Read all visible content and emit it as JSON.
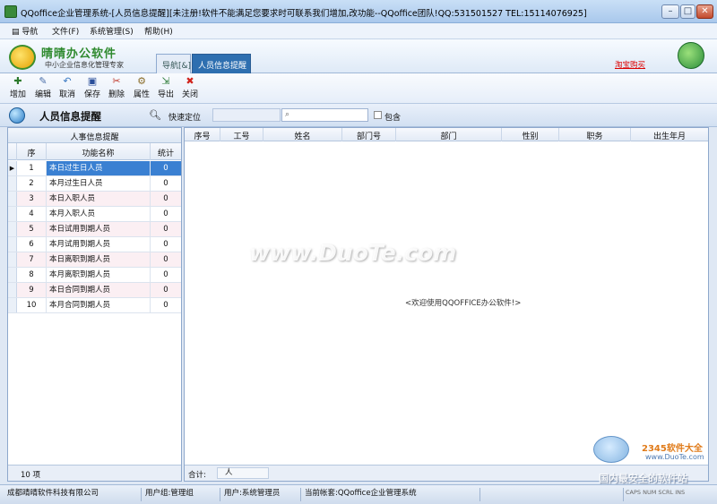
{
  "window": {
    "title": "QQoffice企业管理系统-[人员信息提醒][未注册!软件不能满足您要求时可联系我们增加,改功能--QQoffice团队!QQ:531501527 TEL:15114076925]"
  },
  "menu": {
    "items": [
      {
        "label": "导航"
      },
      {
        "label": "文件(F)"
      },
      {
        "label": "系统管理(S)"
      },
      {
        "label": "帮助(H)"
      }
    ]
  },
  "brand": {
    "title": "晴晴办公软件",
    "subtitle": "中小企业信息化管理专家",
    "taobao": "淘宝购买"
  },
  "tabs": [
    {
      "label": "导航[&]"
    },
    {
      "label": "人员信息提醒"
    }
  ],
  "toolbar": {
    "buttons": [
      {
        "label": "增加",
        "icon": "plus-icon"
      },
      {
        "label": "编辑",
        "icon": "edit-icon"
      },
      {
        "label": "取消",
        "icon": "undo-icon"
      },
      {
        "label": "保存",
        "icon": "save-icon"
      },
      {
        "label": "删除",
        "icon": "delete-icon"
      },
      {
        "label": "属性",
        "icon": "properties-icon"
      },
      {
        "label": "导出",
        "icon": "export-icon"
      },
      {
        "label": "关闭",
        "icon": "close-icon"
      }
    ]
  },
  "section": {
    "title": "人员信息提醒",
    "quick_locate": "快速定位",
    "search_placeholder": "",
    "contains_label": "包含"
  },
  "left_panel": {
    "header": "人事信息提醒",
    "columns": [
      "序",
      "功能名称",
      "统计"
    ],
    "rows": [
      {
        "no": "1",
        "name": "本日过生日人员",
        "count": "0"
      },
      {
        "no": "2",
        "name": "本月过生日人员",
        "count": "0"
      },
      {
        "no": "3",
        "name": "本日入职人员",
        "count": "0"
      },
      {
        "no": "4",
        "name": "本月入职人员",
        "count": "0"
      },
      {
        "no": "5",
        "name": "本日试用到期人员",
        "count": "0"
      },
      {
        "no": "6",
        "name": "本月试用到期人员",
        "count": "0"
      },
      {
        "no": "7",
        "name": "本日离职到期人员",
        "count": "0"
      },
      {
        "no": "8",
        "name": "本月离职到期人员",
        "count": "0"
      },
      {
        "no": "9",
        "name": "本日合同到期人员",
        "count": "0"
      },
      {
        "no": "10",
        "name": "本月合同到期人员",
        "count": "0"
      }
    ],
    "footer": "10 项"
  },
  "right_panel": {
    "columns": [
      "序号",
      "工号",
      "姓名",
      "部门号",
      "部门",
      "性别",
      "职务",
      "出生年月"
    ],
    "welcome": "<欢迎使用QQOFFICE办公软件!>",
    "total_label": "合计:",
    "total_value": "人"
  },
  "status": {
    "company": "成都晴晴软件科技有限公司",
    "usergroup": "用户组:管理组",
    "user": "用户:系统管理员",
    "account": "当前帐套:QQoffice企业管理系统",
    "keys": "CAPS NUM SCRL INS"
  },
  "watermarks": {
    "duote": "www.DuoTe.com",
    "brand2345": "2345软件大全",
    "url": "www.DuoTe.com",
    "slogan": "国内最安全的软件站"
  }
}
